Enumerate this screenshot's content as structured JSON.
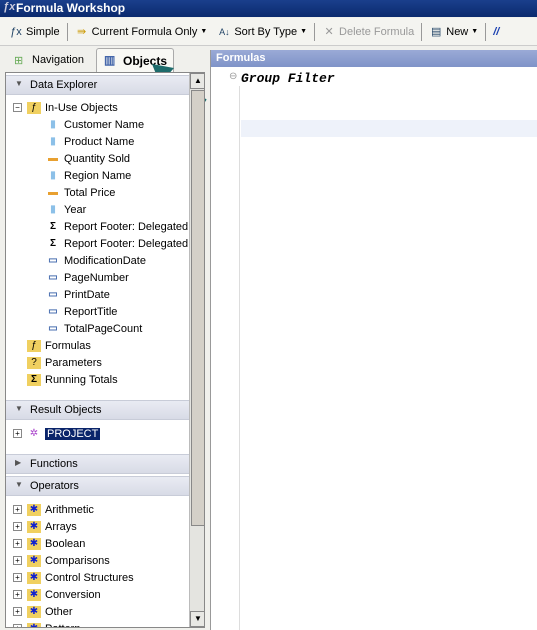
{
  "window": {
    "title": "Formula Workshop"
  },
  "toolbar": {
    "simple": "Simple",
    "current_formula_only": "Current Formula Only",
    "sort_by_type": "Sort By Type",
    "delete_formula": "Delete Formula",
    "new": "New",
    "comment": "//"
  },
  "tabs": [
    {
      "label": "Navigation"
    },
    {
      "label": "Objects",
      "active": true
    }
  ],
  "left": {
    "data_explorer": "Data Explorer",
    "in_use": "In-Use Objects",
    "in_use_items": [
      {
        "label": "Customer Name",
        "icon": "string-field-icon"
      },
      {
        "label": "Product Name",
        "icon": "string-field-icon"
      },
      {
        "label": "Quantity Sold",
        "icon": "number-field-icon"
      },
      {
        "label": "Region Name",
        "icon": "string-field-icon"
      },
      {
        "label": "Total Price",
        "icon": "number-field-icon"
      },
      {
        "label": "Year",
        "icon": "string-field-icon"
      },
      {
        "label": "Report Footer: Delegated",
        "icon": "sum-icon"
      },
      {
        "label": "Report Footer: Delegated",
        "icon": "sum-icon"
      },
      {
        "label": "ModificationDate",
        "icon": "special-field-icon"
      },
      {
        "label": "PageNumber",
        "icon": "special-field-icon"
      },
      {
        "label": "PrintDate",
        "icon": "special-field-icon"
      },
      {
        "label": "ReportTitle",
        "icon": "special-field-icon"
      },
      {
        "label": "TotalPageCount",
        "icon": "special-field-icon"
      }
    ],
    "formulas": "Formulas",
    "parameters": "Parameters",
    "running_totals": "Running Totals",
    "result_objects": "Result Objects",
    "project": "PROJECT",
    "functions": "Functions",
    "operators": "Operators",
    "operator_items": [
      "Arithmetic",
      "Arrays",
      "Boolean",
      "Comparisons",
      "Control Structures",
      "Conversion",
      "Other",
      "Pattern"
    ]
  },
  "right": {
    "header": "Formulas",
    "group_filter": "Group Filter"
  },
  "colors": {
    "title_bar": "#0b2a6e",
    "selection": "#0a246a",
    "formulas_header": "#8a9ccf"
  }
}
